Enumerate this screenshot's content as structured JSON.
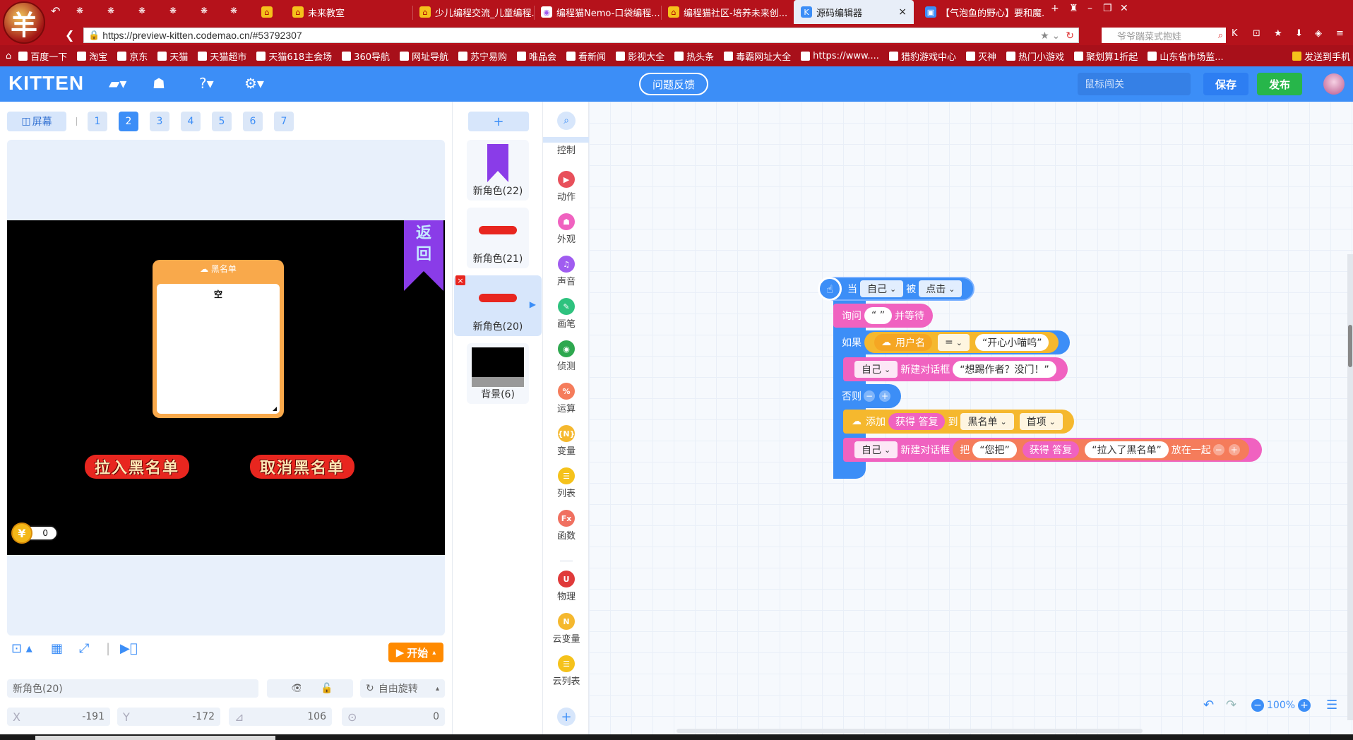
{
  "browser": {
    "logo_char": "羊",
    "tabs": [
      {
        "label": "未来教室",
        "icon": "hat-icon",
        "active": false
      },
      {
        "label": "少儿编程交流_儿童编程...",
        "icon": "hat-icon",
        "active": false
      },
      {
        "label": "编程猫Nemo-口袋编程...",
        "icon": "app-icon",
        "active": false
      },
      {
        "label": "编程猫社区-培养未来创...",
        "icon": "hat-icon",
        "active": false
      },
      {
        "label": "源码编辑器",
        "icon": "kitten-icon",
        "active": true
      },
      {
        "label": "【气泡鱼的野心】要和魔...",
        "icon": "tv-icon",
        "active": false
      }
    ],
    "url": "https://preview-kitten.codemao.cn/#53792307",
    "search_placeholder": "爷爷踹菜式抱娃",
    "bookmarks": [
      "百度一下",
      "淘宝",
      "京东",
      "天猫",
      "天猫超市",
      "天猫618主会场",
      "360导航",
      "网址导航",
      "苏宁易购",
      "唯品会",
      "看新闻",
      "影视大全",
      "热头条",
      "毒霸网址大全",
      "https://www....",
      "猎豹游戏中心",
      "灭神",
      "热门小游戏",
      "聚划算1折起",
      "山东省市场监..."
    ],
    "bookmark_right": "发送到手机"
  },
  "app": {
    "brand": "KITTEN",
    "feedback_label": "问题反馈",
    "level_placeholder": "鼠标闯关",
    "save_label": "保存",
    "publish_label": "发布"
  },
  "stage_panel": {
    "screen_label": "屏幕",
    "scenes": [
      "1",
      "2",
      "3",
      "4",
      "5",
      "6",
      "7"
    ],
    "active_scene": "2",
    "ribbon_text": [
      "返",
      "回"
    ],
    "blacklist_title": "黑名单",
    "blacklist_content": "空",
    "btn_add": "拉入黑名单",
    "btn_remove": "取消黑名单",
    "coin_symbol": "¥",
    "coin_count": "0",
    "start_label": "开始",
    "sprite_name": "新角色(20)",
    "rotation_label": "自由旋转",
    "x_label": "X",
    "x_value": "-191",
    "y_label": "Y",
    "y_value": "-172",
    "size_value": "106",
    "direction_value": "0"
  },
  "sprites": {
    "add_label": "+",
    "items": [
      {
        "label": "新角色(22)",
        "thumb": "ribbon"
      },
      {
        "label": "新角色(21)",
        "thumb": "red-button"
      },
      {
        "label": "新角色(20)",
        "thumb": "red-button"
      },
      {
        "label": "背景(6)",
        "thumb": "black-bg"
      }
    ]
  },
  "categories": [
    {
      "label": "控制",
      "color": "#f5a623",
      "icon": "control-icon"
    },
    {
      "label": "动作",
      "color": "#e8505b",
      "icon": "motion-icon"
    },
    {
      "label": "外观",
      "color": "#f062c0",
      "icon": "looks-icon"
    },
    {
      "label": "声音",
      "color": "#a05cf0",
      "icon": "sound-icon"
    },
    {
      "label": "画笔",
      "color": "#2ec27e",
      "icon": "pen-icon"
    },
    {
      "label": "侦测",
      "color": "#2ea84f",
      "icon": "sensing-icon"
    },
    {
      "label": "运算",
      "color": "#f57c5b",
      "icon": "operator-icon"
    },
    {
      "label": "变量",
      "color": "#f5b82e",
      "icon": "variable-icon"
    },
    {
      "label": "列表",
      "color": "#f5c21b",
      "icon": "list-icon"
    },
    {
      "label": "函数",
      "color": "#f07060",
      "icon": "function-icon"
    },
    {
      "label": "物理",
      "color": "#e03a3a",
      "icon": "physics-icon"
    },
    {
      "label": "云变量",
      "color": "#f5b82e",
      "icon": "cloud-variable-icon"
    },
    {
      "label": "云列表",
      "color": "#f5c21b",
      "icon": "cloud-list-icon"
    }
  ],
  "code": {
    "when": "当",
    "self": "自己",
    "being": "被",
    "clicked": "点击",
    "ask": "询问",
    "empty_str": "“ ”",
    "and_wait": "并等待",
    "if": "如果",
    "username": "用户名",
    "equals": "=",
    "happy_cat": "“开心小喵呜”",
    "new_dialog": "新建对话框",
    "no_kick": "“想踢作者？没门！”",
    "else": "否则",
    "add": "添加",
    "get_answer": "获得 答复",
    "to": "到",
    "blacklist": "黑名单",
    "first_item": "首项",
    "put": "把",
    "you_put": "“您把”",
    "added_to_bl": "“拉入了黑名单”",
    "together": "放在一起"
  },
  "workspace": {
    "zoom": "100%"
  }
}
